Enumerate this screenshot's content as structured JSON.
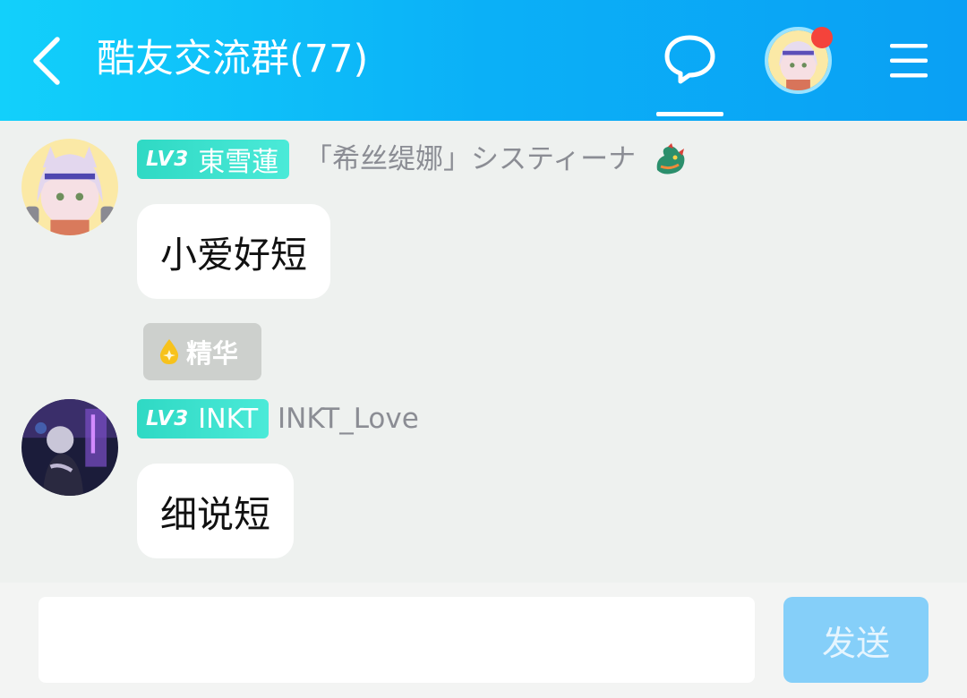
{
  "header": {
    "title": "酷友交流群(77)",
    "has_notification": true
  },
  "messages": [
    {
      "level": "LV3",
      "badge_name": "東雪蓮",
      "nickname": "「希丝缇娜」システィーナ",
      "text": "小爱好短",
      "essence_tag": "精华"
    },
    {
      "level": "LV3",
      "badge_name": "INKT",
      "nickname": "INKT_Love",
      "text": "细说短"
    }
  ],
  "composer": {
    "placeholder": "",
    "send_label": "发送"
  },
  "colors": {
    "header_gradient_start": "#12d0fb",
    "header_gradient_end": "#0aa0f4",
    "badge": "#2fd9c4",
    "notification_dot": "#f4433b",
    "send_button": "#85cff9"
  },
  "icons": [
    "back-arrow-icon",
    "chat-bubble-icon",
    "menu-icon",
    "essence-drop-icon",
    "dragon-emblem-icon"
  ]
}
